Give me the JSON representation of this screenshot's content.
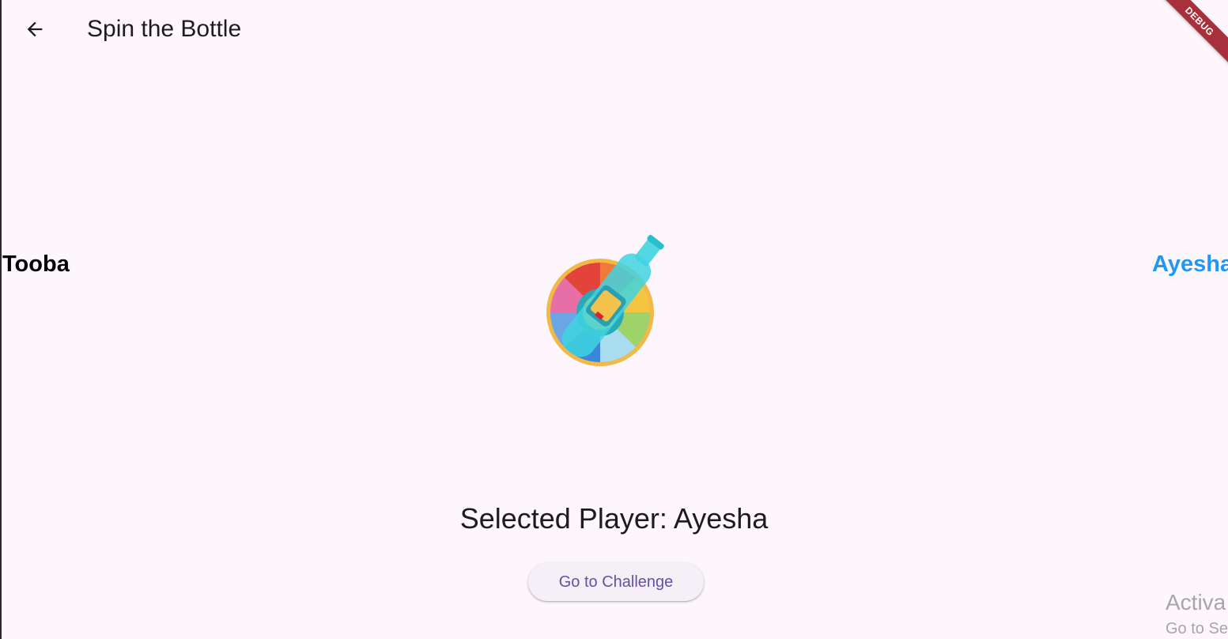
{
  "appbar": {
    "title": "Spin the Bottle",
    "back_icon": "arrow-left-icon"
  },
  "debug_banner": "DEBUG",
  "players": {
    "left": "Tooba",
    "right": "Ayesha"
  },
  "colors": {
    "background": "#fdf7fd",
    "highlight_player": "#2196f3",
    "button_text": "#6750a4",
    "debug_banner": "#a8303a"
  },
  "wheel_icon": "spin-bottle-wheel",
  "selected_text": "Selected Player: Ayesha",
  "challenge_button": "Go to Challenge",
  "watermark": {
    "line1": "Activa",
    "line2": "Go to Se"
  }
}
